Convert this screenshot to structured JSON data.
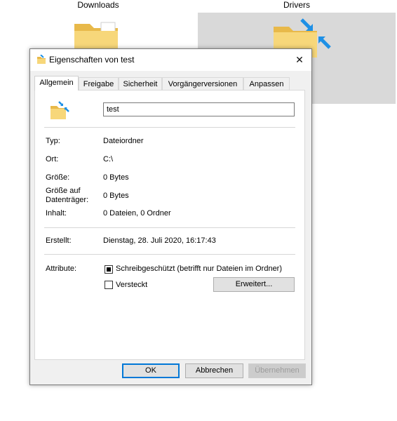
{
  "explorer": {
    "tiles": [
      {
        "label": "Downloads"
      },
      {
        "label": "Drivers"
      }
    ]
  },
  "dialog": {
    "title": "Eigenschaften von test",
    "close_icon": "close-icon",
    "tabs": [
      {
        "label": "Allgemein",
        "active": true
      },
      {
        "label": "Freigabe"
      },
      {
        "label": "Sicherheit"
      },
      {
        "label": "Vorgängerversionen"
      },
      {
        "label": "Anpassen"
      }
    ],
    "general": {
      "name_value": "test",
      "rows": [
        {
          "label": "Typ:",
          "value": "Dateiordner"
        },
        {
          "label": "Ort:",
          "value": "C:\\"
        },
        {
          "label": "Größe:",
          "value": "0 Bytes"
        },
        {
          "label": "Größe auf Datenträger:",
          "value": "0 Bytes"
        },
        {
          "label": "Inhalt:",
          "value": "0 Dateien, 0 Ordner"
        }
      ],
      "created_label": "Erstellt:",
      "created_value": "Dienstag, 28. Juli 2020, 16:17:43",
      "attributes_label": "Attribute:",
      "readonly_label": "Schreibgeschützt (betrifft nur Dateien im Ordner)",
      "readonly_state": "indeterminate",
      "hidden_label": "Versteckt",
      "hidden_state": "unchecked",
      "advanced_button": "Erweitert..."
    },
    "buttons": {
      "ok": "OK",
      "cancel": "Abbrechen",
      "apply": "Übernehmen"
    }
  },
  "colors": {
    "accent": "#0078d7",
    "folder": "#f5d06b",
    "selection_bg": "#d9d9d9"
  }
}
